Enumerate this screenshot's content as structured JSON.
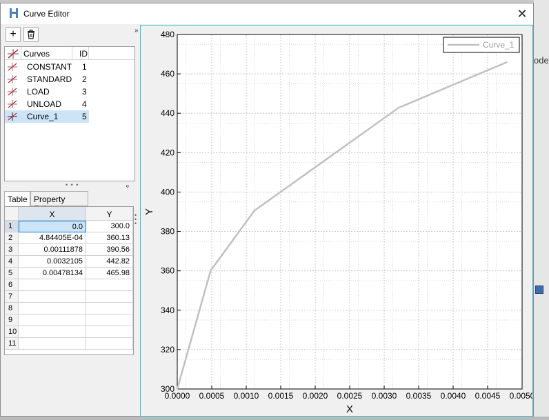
{
  "window": {
    "title": "Curve Editor",
    "close_glyph": "✕",
    "background_right_text": "ode"
  },
  "toolbar": {
    "add_glyph": "+",
    "delete_icon": "trash-icon",
    "collapse_glyph": "»"
  },
  "curves_list": {
    "header_curves": "Curves",
    "header_id": "ID",
    "items": [
      {
        "name": "CONSTANT",
        "id": "1"
      },
      {
        "name": "STANDARD",
        "id": "2"
      },
      {
        "name": "LOAD",
        "id": "3"
      },
      {
        "name": "UNLOAD",
        "id": "4"
      },
      {
        "name": "Curve_1",
        "id": "5",
        "selected": true
      }
    ],
    "splitter_dots": "• • •",
    "splitter_arrow": "»"
  },
  "tabs": [
    {
      "label": "Table",
      "active": true
    },
    {
      "label": "Property Editor",
      "active": false
    }
  ],
  "table": {
    "col_x": "X",
    "col_y": "Y",
    "rows": [
      {
        "n": "1",
        "x": "0.0",
        "y": "300.0"
      },
      {
        "n": "2",
        "x": "4.84405E-04",
        "y": "360.13"
      },
      {
        "n": "3",
        "x": "0.00111878",
        "y": "390.56"
      },
      {
        "n": "4",
        "x": "0.0032105",
        "y": "442.82"
      },
      {
        "n": "5",
        "x": "0.00478134",
        "y": "465.98"
      },
      {
        "n": "6",
        "x": "",
        "y": ""
      },
      {
        "n": "7",
        "x": "",
        "y": ""
      },
      {
        "n": "8",
        "x": "",
        "y": ""
      },
      {
        "n": "9",
        "x": "",
        "y": ""
      },
      {
        "n": "10",
        "x": "",
        "y": ""
      },
      {
        "n": "11",
        "x": "",
        "y": ""
      }
    ]
  },
  "colors": {
    "accent": "#2ec4cf",
    "selection": "#cce4f7",
    "curve_line": "#c0c0c0"
  },
  "chart_data": {
    "type": "line",
    "xlabel": "X",
    "ylabel": "Y",
    "xlim": [
      0,
      0.005
    ],
    "ylim": [
      300,
      480
    ],
    "xticks": [
      "0.0000",
      "0.0005",
      "0.0010",
      "0.0015",
      "0.0020",
      "0.0025",
      "0.0030",
      "0.0035",
      "0.0040",
      "0.0045",
      "0.0050"
    ],
    "yticks": [
      "300",
      "320",
      "340",
      "360",
      "380",
      "400",
      "420",
      "440",
      "460",
      "480"
    ],
    "grid": true,
    "legend_position": "top-right",
    "series": [
      {
        "name": "Curve_1",
        "x": [
          0.0,
          0.000484405,
          0.00111878,
          0.0032105,
          0.00478134
        ],
        "y": [
          300.0,
          360.13,
          390.56,
          442.82,
          465.98
        ]
      }
    ]
  }
}
